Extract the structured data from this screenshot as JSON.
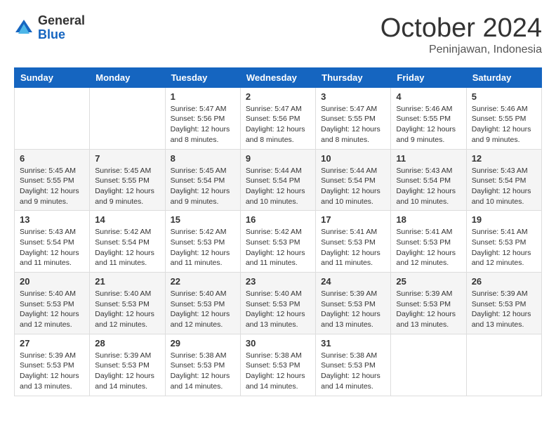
{
  "header": {
    "logo_general": "General",
    "logo_blue": "Blue",
    "month_title": "October 2024",
    "location": "Peninjawan, Indonesia"
  },
  "calendar": {
    "days_of_week": [
      "Sunday",
      "Monday",
      "Tuesday",
      "Wednesday",
      "Thursday",
      "Friday",
      "Saturday"
    ],
    "weeks": [
      [
        {
          "day": "",
          "content": ""
        },
        {
          "day": "",
          "content": ""
        },
        {
          "day": "1",
          "content": "Sunrise: 5:47 AM\nSunset: 5:56 PM\nDaylight: 12 hours and 8 minutes."
        },
        {
          "day": "2",
          "content": "Sunrise: 5:47 AM\nSunset: 5:56 PM\nDaylight: 12 hours and 8 minutes."
        },
        {
          "day": "3",
          "content": "Sunrise: 5:47 AM\nSunset: 5:55 PM\nDaylight: 12 hours and 8 minutes."
        },
        {
          "day": "4",
          "content": "Sunrise: 5:46 AM\nSunset: 5:55 PM\nDaylight: 12 hours and 9 minutes."
        },
        {
          "day": "5",
          "content": "Sunrise: 5:46 AM\nSunset: 5:55 PM\nDaylight: 12 hours and 9 minutes."
        }
      ],
      [
        {
          "day": "6",
          "content": "Sunrise: 5:45 AM\nSunset: 5:55 PM\nDaylight: 12 hours and 9 minutes."
        },
        {
          "day": "7",
          "content": "Sunrise: 5:45 AM\nSunset: 5:55 PM\nDaylight: 12 hours and 9 minutes."
        },
        {
          "day": "8",
          "content": "Sunrise: 5:45 AM\nSunset: 5:54 PM\nDaylight: 12 hours and 9 minutes."
        },
        {
          "day": "9",
          "content": "Sunrise: 5:44 AM\nSunset: 5:54 PM\nDaylight: 12 hours and 10 minutes."
        },
        {
          "day": "10",
          "content": "Sunrise: 5:44 AM\nSunset: 5:54 PM\nDaylight: 12 hours and 10 minutes."
        },
        {
          "day": "11",
          "content": "Sunrise: 5:43 AM\nSunset: 5:54 PM\nDaylight: 12 hours and 10 minutes."
        },
        {
          "day": "12",
          "content": "Sunrise: 5:43 AM\nSunset: 5:54 PM\nDaylight: 12 hours and 10 minutes."
        }
      ],
      [
        {
          "day": "13",
          "content": "Sunrise: 5:43 AM\nSunset: 5:54 PM\nDaylight: 12 hours and 11 minutes."
        },
        {
          "day": "14",
          "content": "Sunrise: 5:42 AM\nSunset: 5:54 PM\nDaylight: 12 hours and 11 minutes."
        },
        {
          "day": "15",
          "content": "Sunrise: 5:42 AM\nSunset: 5:53 PM\nDaylight: 12 hours and 11 minutes."
        },
        {
          "day": "16",
          "content": "Sunrise: 5:42 AM\nSunset: 5:53 PM\nDaylight: 12 hours and 11 minutes."
        },
        {
          "day": "17",
          "content": "Sunrise: 5:41 AM\nSunset: 5:53 PM\nDaylight: 12 hours and 11 minutes."
        },
        {
          "day": "18",
          "content": "Sunrise: 5:41 AM\nSunset: 5:53 PM\nDaylight: 12 hours and 12 minutes."
        },
        {
          "day": "19",
          "content": "Sunrise: 5:41 AM\nSunset: 5:53 PM\nDaylight: 12 hours and 12 minutes."
        }
      ],
      [
        {
          "day": "20",
          "content": "Sunrise: 5:40 AM\nSunset: 5:53 PM\nDaylight: 12 hours and 12 minutes."
        },
        {
          "day": "21",
          "content": "Sunrise: 5:40 AM\nSunset: 5:53 PM\nDaylight: 12 hours and 12 minutes."
        },
        {
          "day": "22",
          "content": "Sunrise: 5:40 AM\nSunset: 5:53 PM\nDaylight: 12 hours and 12 minutes."
        },
        {
          "day": "23",
          "content": "Sunrise: 5:40 AM\nSunset: 5:53 PM\nDaylight: 12 hours and 13 minutes."
        },
        {
          "day": "24",
          "content": "Sunrise: 5:39 AM\nSunset: 5:53 PM\nDaylight: 12 hours and 13 minutes."
        },
        {
          "day": "25",
          "content": "Sunrise: 5:39 AM\nSunset: 5:53 PM\nDaylight: 12 hours and 13 minutes."
        },
        {
          "day": "26",
          "content": "Sunrise: 5:39 AM\nSunset: 5:53 PM\nDaylight: 12 hours and 13 minutes."
        }
      ],
      [
        {
          "day": "27",
          "content": "Sunrise: 5:39 AM\nSunset: 5:53 PM\nDaylight: 12 hours and 13 minutes."
        },
        {
          "day": "28",
          "content": "Sunrise: 5:39 AM\nSunset: 5:53 PM\nDaylight: 12 hours and 14 minutes."
        },
        {
          "day": "29",
          "content": "Sunrise: 5:38 AM\nSunset: 5:53 PM\nDaylight: 12 hours and 14 minutes."
        },
        {
          "day": "30",
          "content": "Sunrise: 5:38 AM\nSunset: 5:53 PM\nDaylight: 12 hours and 14 minutes."
        },
        {
          "day": "31",
          "content": "Sunrise: 5:38 AM\nSunset: 5:53 PM\nDaylight: 12 hours and 14 minutes."
        },
        {
          "day": "",
          "content": ""
        },
        {
          "day": "",
          "content": ""
        }
      ]
    ]
  }
}
